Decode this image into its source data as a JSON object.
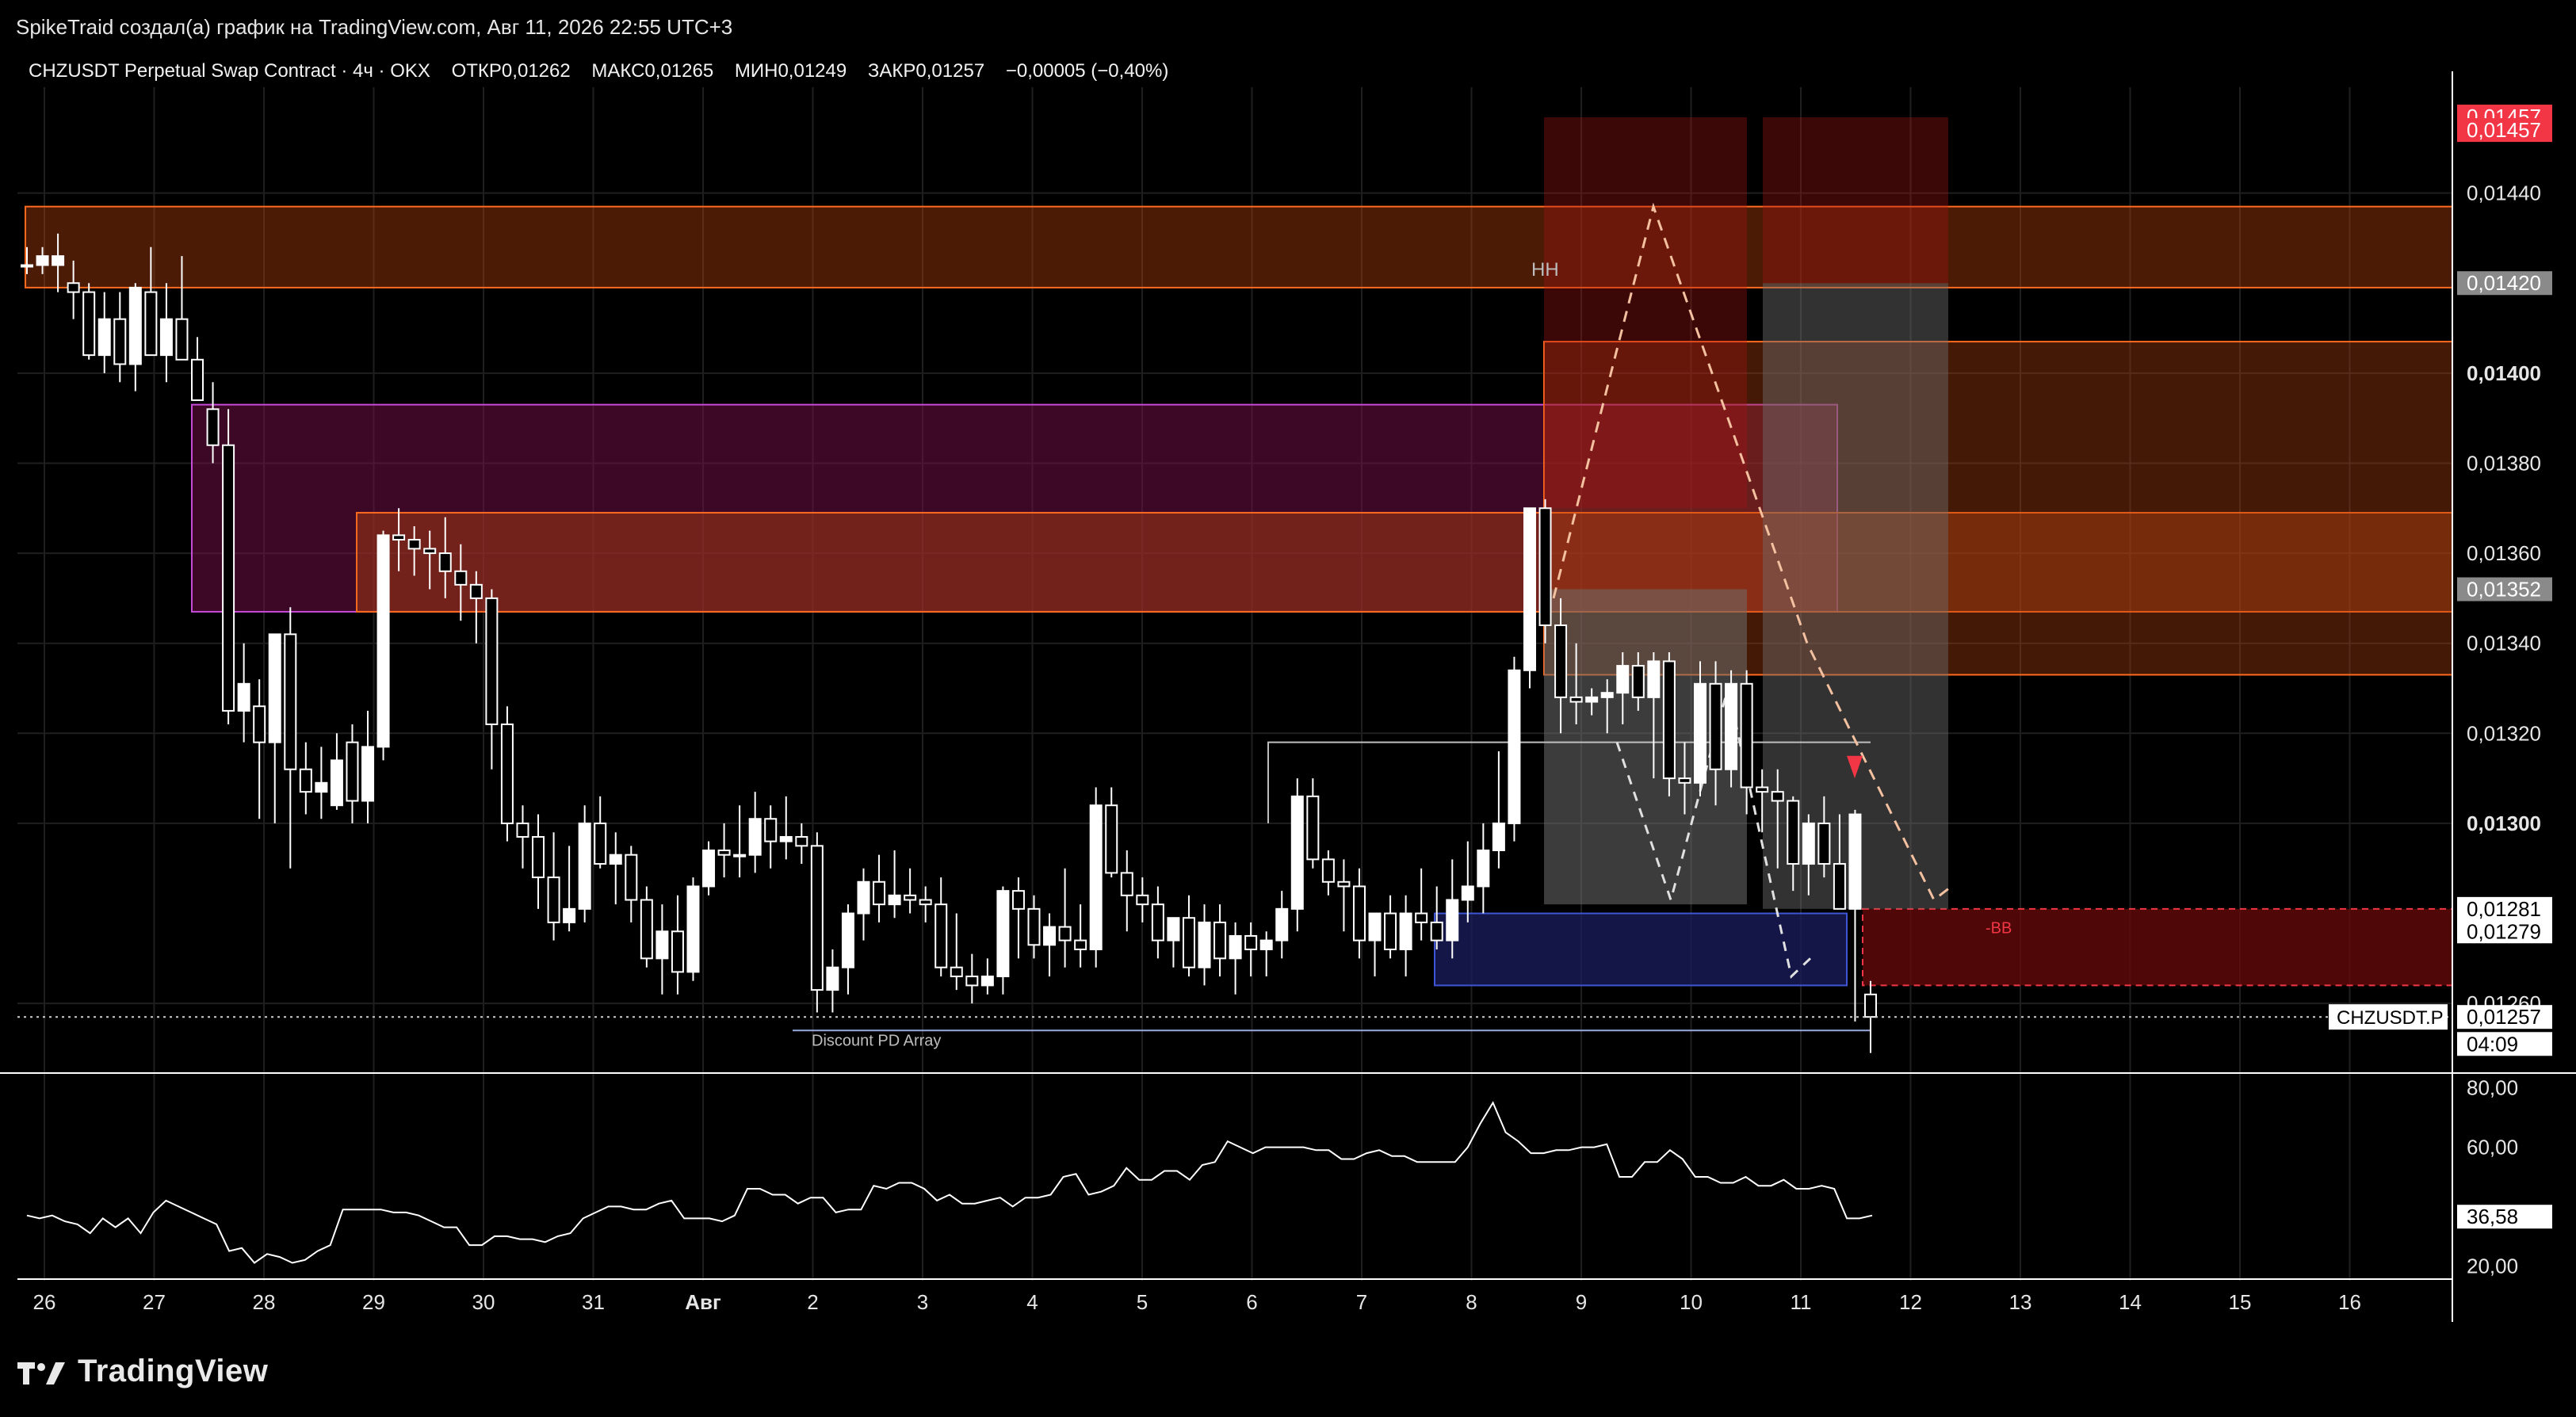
{
  "header": {
    "created_by": "SpikeTraid создал(а) график на TradingView.com, Авг 11, 2026 22:55 UTC+3"
  },
  "legend": {
    "symbol": "CHZUSDT Perpetual Swap Contract · 4ч · OKX",
    "open_label": "ОТКР",
    "open": "0,01262",
    "high_label": "МАКС",
    "high": "0,01265",
    "low_label": "МИН",
    "low": "0,01249",
    "close_label": "ЗАКР",
    "close": "0,01257",
    "change": "−0,00005 (−0,40%)"
  },
  "colors": {
    "background": "#000000",
    "grid": "#1f1f1f",
    "candle": "#ffffff",
    "supply_zone": "#b3410f",
    "supply_zone_border": "#ff6a1f",
    "purple_zone": "#4a0b2c",
    "purple_border": "#c64bd8",
    "blue_zone": "#1a1d55",
    "blue_border": "#3e56d6",
    "red_zone": "#6b0a0a",
    "red_tag": "#f23645",
    "stop_zone": "#5a1414",
    "target_zone": "#5a5a5a"
  },
  "chart_data": {
    "type": "candlestick",
    "timeframe": "4ч",
    "price_axis": {
      "min": 0.01247,
      "max": 0.0146,
      "ticks": [
        "0,01440",
        "0,01400",
        "0,01380",
        "0,01360",
        "0,01340",
        "0,01320",
        "0,01300",
        "0,01260"
      ],
      "bold_ticks": [
        "0,01400",
        "0,01300"
      ]
    },
    "price_tags": [
      {
        "value": 0.01457,
        "text": "0,01457",
        "style": "red"
      },
      {
        "value": 0.01454,
        "text": "0,01457",
        "style": "red"
      },
      {
        "value": 0.0142,
        "text": "0,01420",
        "style": "gray"
      },
      {
        "value": 0.01352,
        "text": "0,01352",
        "style": "gray"
      },
      {
        "value": 0.01281,
        "text": "0,01281",
        "style": "white"
      },
      {
        "value": 0.01276,
        "text": "0,01279",
        "style": "white"
      },
      {
        "value": 0.01257,
        "text": "0,01257",
        "style": "white"
      },
      {
        "value": 0.01251,
        "text": "04:09",
        "style": "white-sub"
      }
    ],
    "symbol_tag": "CHZUSDT.P",
    "last_price": 0.01257,
    "time_axis": {
      "labels": [
        "26",
        "27",
        "28",
        "29",
        "30",
        "31",
        "Авг",
        "2",
        "3",
        "4",
        "5",
        "6",
        "7",
        "8",
        "9",
        "10",
        "11",
        "12",
        "13",
        "14",
        "15",
        "16"
      ],
      "bold_labels": [
        "Авг"
      ]
    },
    "candles": [
      [
        0.01424,
        0.01428,
        0.01422,
        0.01424
      ],
      [
        0.01424,
        0.01428,
        0.01422,
        0.01426
      ],
      [
        0.01424,
        0.01431,
        0.01418,
        0.01426
      ],
      [
        0.0142,
        0.01425,
        0.01412,
        0.01418
      ],
      [
        0.01418,
        0.0142,
        0.01403,
        0.01404
      ],
      [
        0.01404,
        0.01418,
        0.014,
        0.01412
      ],
      [
        0.01412,
        0.01418,
        0.01398,
        0.01402
      ],
      [
        0.01402,
        0.0142,
        0.01396,
        0.01419
      ],
      [
        0.01418,
        0.01428,
        0.01408,
        0.01404
      ],
      [
        0.01404,
        0.0142,
        0.01398,
        0.01412
      ],
      [
        0.01412,
        0.01426,
        0.01404,
        0.01403
      ],
      [
        0.01403,
        0.01408,
        0.01396,
        0.01394
      ],
      [
        0.01392,
        0.01398,
        0.0138,
        0.01384
      ],
      [
        0.01384,
        0.01392,
        0.01322,
        0.01325
      ],
      [
        0.01325,
        0.0134,
        0.01318,
        0.01331
      ],
      [
        0.01326,
        0.01332,
        0.01301,
        0.01318
      ],
      [
        0.01318,
        0.01342,
        0.013,
        0.01342
      ],
      [
        0.01342,
        0.01348,
        0.0129,
        0.01312
      ],
      [
        0.01312,
        0.01318,
        0.01302,
        0.01307
      ],
      [
        0.01307,
        0.01317,
        0.01301,
        0.01309
      ],
      [
        0.01304,
        0.0132,
        0.01303,
        0.01314
      ],
      [
        0.01318,
        0.01322,
        0.013,
        0.01305
      ],
      [
        0.01305,
        0.01325,
        0.013,
        0.01317
      ],
      [
        0.01317,
        0.01365,
        0.01314,
        0.01364
      ],
      [
        0.01364,
        0.0137,
        0.01356,
        0.01363
      ],
      [
        0.01363,
        0.01366,
        0.01355,
        0.01361
      ],
      [
        0.01361,
        0.01365,
        0.01352,
        0.0136
      ],
      [
        0.0136,
        0.01368,
        0.0135,
        0.01356
      ],
      [
        0.01356,
        0.01362,
        0.01345,
        0.01353
      ],
      [
        0.01353,
        0.01356,
        0.0134,
        0.0135
      ],
      [
        0.0135,
        0.01352,
        0.01312,
        0.01322
      ],
      [
        0.01322,
        0.01326,
        0.01296,
        0.013
      ],
      [
        0.013,
        0.01304,
        0.0129,
        0.01297
      ],
      [
        0.01297,
        0.01302,
        0.01281,
        0.01288
      ],
      [
        0.01288,
        0.01298,
        0.01274,
        0.01278
      ],
      [
        0.01278,
        0.01295,
        0.01276,
        0.01281
      ],
      [
        0.01281,
        0.01304,
        0.01278,
        0.013
      ],
      [
        0.013,
        0.01306,
        0.0129,
        0.01291
      ],
      [
        0.01291,
        0.01298,
        0.01282,
        0.01293
      ],
      [
        0.01293,
        0.01295,
        0.01278,
        0.01283
      ],
      [
        0.01283,
        0.01286,
        0.01268,
        0.0127
      ],
      [
        0.0127,
        0.01282,
        0.01262,
        0.01276
      ],
      [
        0.01276,
        0.01284,
        0.01262,
        0.01267
      ],
      [
        0.01267,
        0.01288,
        0.01265,
        0.01286
      ],
      [
        0.01286,
        0.01296,
        0.01284,
        0.01294
      ],
      [
        0.01294,
        0.013,
        0.01288,
        0.01293
      ],
      [
        0.01293,
        0.01304,
        0.01288,
        0.01293
      ],
      [
        0.01293,
        0.01307,
        0.01289,
        0.01301
      ],
      [
        0.01301,
        0.01304,
        0.0129,
        0.01296
      ],
      [
        0.01296,
        0.01306,
        0.01292,
        0.01297
      ],
      [
        0.01297,
        0.013,
        0.01291,
        0.01295
      ],
      [
        0.01295,
        0.01298,
        0.01258,
        0.01263
      ],
      [
        0.01263,
        0.01272,
        0.01258,
        0.01268
      ],
      [
        0.01268,
        0.01282,
        0.01262,
        0.0128
      ],
      [
        0.0128,
        0.0129,
        0.01274,
        0.01287
      ],
      [
        0.01287,
        0.01293,
        0.01278,
        0.01282
      ],
      [
        0.01282,
        0.01294,
        0.01279,
        0.01284
      ],
      [
        0.01284,
        0.0129,
        0.0128,
        0.01283
      ],
      [
        0.01283,
        0.01286,
        0.01278,
        0.01282
      ],
      [
        0.01282,
        0.01288,
        0.01266,
        0.01268
      ],
      [
        0.01268,
        0.0128,
        0.01263,
        0.01266
      ],
      [
        0.01266,
        0.01271,
        0.0126,
        0.01264
      ],
      [
        0.01264,
        0.0127,
        0.01262,
        0.01266
      ],
      [
        0.01266,
        0.01286,
        0.01262,
        0.01285
      ],
      [
        0.01285,
        0.01288,
        0.0127,
        0.01281
      ],
      [
        0.01281,
        0.01284,
        0.0127,
        0.01273
      ],
      [
        0.01273,
        0.0128,
        0.01266,
        0.01277
      ],
      [
        0.01277,
        0.0129,
        0.01268,
        0.01274
      ],
      [
        0.01274,
        0.01282,
        0.01268,
        0.01272
      ],
      [
        0.01272,
        0.01308,
        0.01268,
        0.01304
      ],
      [
        0.01304,
        0.01308,
        0.01288,
        0.01289
      ],
      [
        0.01289,
        0.01294,
        0.01276,
        0.01284
      ],
      [
        0.01284,
        0.01288,
        0.01278,
        0.01282
      ],
      [
        0.01282,
        0.01286,
        0.0127,
        0.01274
      ],
      [
        0.01274,
        0.01278,
        0.01268,
        0.01279
      ],
      [
        0.01279,
        0.01284,
        0.01266,
        0.01268
      ],
      [
        0.01268,
        0.01282,
        0.01264,
        0.01278
      ],
      [
        0.01278,
        0.01282,
        0.01266,
        0.0127
      ],
      [
        0.0127,
        0.01278,
        0.01262,
        0.01275
      ],
      [
        0.01275,
        0.01278,
        0.01266,
        0.01272
      ],
      [
        0.01272,
        0.01276,
        0.01266,
        0.01274
      ],
      [
        0.01274,
        0.01285,
        0.0127,
        0.01281
      ],
      [
        0.01281,
        0.0131,
        0.01276,
        0.01306
      ],
      [
        0.01306,
        0.0131,
        0.0129,
        0.01292
      ],
      [
        0.01292,
        0.01294,
        0.01284,
        0.01287
      ],
      [
        0.01287,
        0.01292,
        0.01276,
        0.01286
      ],
      [
        0.01286,
        0.0129,
        0.0127,
        0.01274
      ],
      [
        0.01274,
        0.01276,
        0.01266,
        0.0128
      ],
      [
        0.0128,
        0.01284,
        0.0127,
        0.01272
      ],
      [
        0.01272,
        0.01284,
        0.01266,
        0.0128
      ],
      [
        0.0128,
        0.0129,
        0.01274,
        0.01278
      ],
      [
        0.01278,
        0.01286,
        0.01272,
        0.01274
      ],
      [
        0.01274,
        0.01292,
        0.0127,
        0.01283
      ],
      [
        0.01283,
        0.01296,
        0.01278,
        0.01286
      ],
      [
        0.01286,
        0.013,
        0.0128,
        0.01294
      ],
      [
        0.01294,
        0.01316,
        0.0129,
        0.013
      ],
      [
        0.013,
        0.01337,
        0.01296,
        0.01334
      ],
      [
        0.01334,
        0.0137,
        0.0133,
        0.0137
      ],
      [
        0.0137,
        0.01372,
        0.0134,
        0.01344
      ],
      [
        0.01344,
        0.0135,
        0.0132,
        0.01328
      ],
      [
        0.01328,
        0.0134,
        0.01322,
        0.01327
      ],
      [
        0.01327,
        0.0133,
        0.01324,
        0.01328
      ],
      [
        0.01328,
        0.01332,
        0.0132,
        0.01329
      ],
      [
        0.01329,
        0.01338,
        0.01322,
        0.01335
      ],
      [
        0.01335,
        0.01338,
        0.01325,
        0.01328
      ],
      [
        0.01328,
        0.01338,
        0.0131,
        0.01336
      ],
      [
        0.01336,
        0.01338,
        0.01306,
        0.0131
      ],
      [
        0.0131,
        0.01318,
        0.01302,
        0.01309
      ],
      [
        0.01309,
        0.01336,
        0.01306,
        0.01331
      ],
      [
        0.01331,
        0.01336,
        0.01304,
        0.01312
      ],
      [
        0.01312,
        0.01334,
        0.01308,
        0.01331
      ],
      [
        0.01331,
        0.01334,
        0.01302,
        0.01308
      ],
      [
        0.01308,
        0.01312,
        0.01298,
        0.01307
      ],
      [
        0.01307,
        0.01312,
        0.0129,
        0.01305
      ],
      [
        0.01305,
        0.01306,
        0.01285,
        0.01291
      ],
      [
        0.01291,
        0.01302,
        0.01284,
        0.013
      ],
      [
        0.013,
        0.01306,
        0.01288,
        0.01291
      ],
      [
        0.01291,
        0.01302,
        0.01286,
        0.01281
      ],
      [
        0.01281,
        0.01303,
        0.01256,
        0.01302
      ],
      [
        0.01262,
        0.01265,
        0.01249,
        0.01257
      ]
    ],
    "zones": [
      {
        "name": "supply-top",
        "from": 0.01437,
        "to": 0.01419,
        "color": "orange"
      },
      {
        "name": "supply-purple",
        "from": 0.01393,
        "to": 0.01347,
        "color": "purple"
      },
      {
        "name": "supply-mid",
        "from": 0.01369,
        "to": 0.01347,
        "color": "orange"
      },
      {
        "name": "supply-right",
        "from": 0.01407,
        "to": 0.01333,
        "color": "orange"
      },
      {
        "name": "demand-blue",
        "from": 0.0128,
        "to": 0.01264,
        "color": "blue"
      },
      {
        "name": "red-target",
        "from": 0.01281,
        "to": 0.01264,
        "color": "red"
      }
    ],
    "annotations": [
      {
        "text": "HH",
        "value": 0.01423
      },
      {
        "text": "Discount PD Array",
        "value": 0.01252
      },
      {
        "text": "-BB",
        "value": 0.01277
      }
    ],
    "oscillator": {
      "ticks": [
        "80,00",
        "60,00",
        "20,00"
      ],
      "tag": "36,58",
      "min": 15,
      "max": 85,
      "values": [
        37,
        36,
        37,
        35,
        34,
        31,
        36,
        33,
        36,
        31,
        38,
        42,
        40,
        38,
        36,
        34,
        25,
        26,
        21,
        24,
        23,
        21,
        22,
        25,
        27,
        39,
        39,
        39,
        39,
        38,
        38,
        37,
        35,
        33,
        33,
        27,
        27,
        30,
        30,
        29,
        29,
        28,
        30,
        31,
        36,
        38,
        40,
        40,
        39,
        39,
        41,
        42,
        36,
        36,
        36,
        35,
        37,
        46,
        46,
        44,
        44,
        41,
        43,
        43,
        38,
        39,
        39,
        47,
        46,
        48,
        48,
        46,
        42,
        44,
        41,
        41,
        42,
        43,
        40,
        43,
        43,
        44,
        50,
        51,
        44,
        45,
        47,
        53,
        49,
        49,
        52,
        52,
        49,
        54,
        55,
        62,
        60,
        58,
        60,
        60,
        60,
        60,
        59,
        59,
        56,
        56,
        58,
        59,
        57,
        57,
        55,
        55,
        55,
        55,
        60,
        68,
        75,
        65,
        62,
        58,
        58,
        59,
        59,
        60,
        60,
        61,
        50,
        50,
        55,
        55,
        59,
        56,
        50,
        50,
        48,
        48,
        50,
        47,
        47,
        49,
        46,
        46,
        47,
        46,
        36,
        36,
        37
      ]
    },
    "xlabel": "",
    "ylabel": ""
  },
  "brand": {
    "name": "TradingView"
  }
}
